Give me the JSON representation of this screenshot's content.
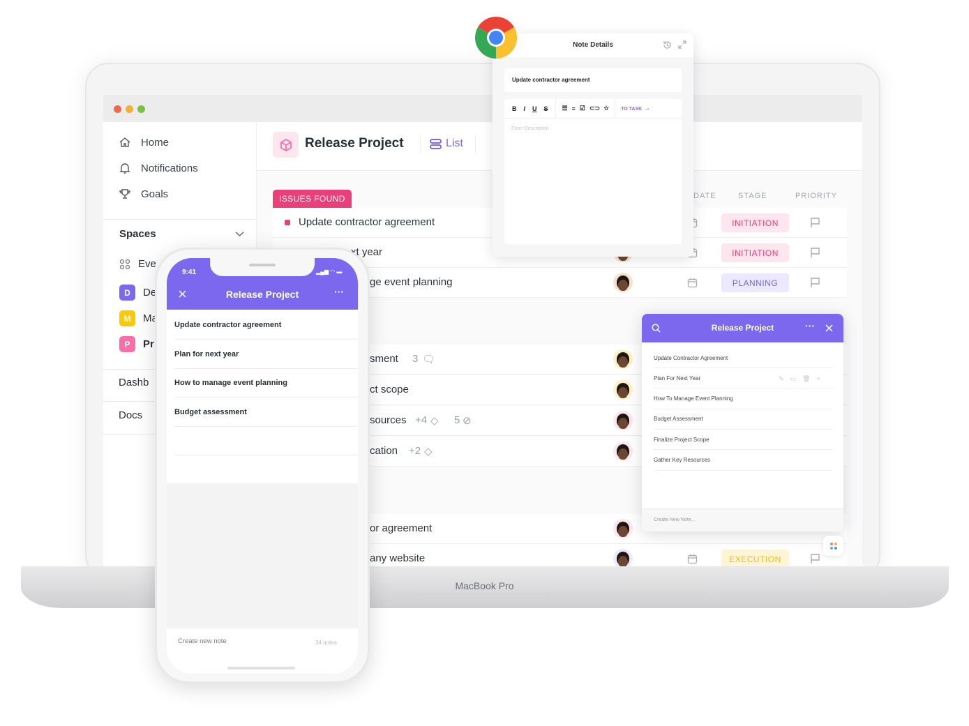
{
  "window": {
    "traffic_light_colors": [
      "#ee6a4a",
      "#f1b132",
      "#7ac142"
    ]
  },
  "sidebar": {
    "nav": [
      {
        "label": "Home",
        "icon": "home-icon"
      },
      {
        "label": "Notifications",
        "icon": "bell-icon"
      },
      {
        "label": "Goals",
        "icon": "trophy-icon"
      }
    ],
    "spaces_label": "Spaces",
    "spaces": [
      {
        "label": "Eve",
        "icon": "grid-icon"
      },
      {
        "badge": "D",
        "label": "De",
        "color": "#7b68ee"
      },
      {
        "badge": "M",
        "label": "Ma",
        "color": "#ffc800"
      },
      {
        "badge": "P",
        "label": "Pr",
        "color": "#f76fa8"
      }
    ],
    "dashboards": "Dashb",
    "docs": "Docs"
  },
  "header": {
    "title": "Release Project",
    "view": "List"
  },
  "columns": {
    "date": "DATE",
    "stage": "STAGE",
    "priority": "PRIORITY"
  },
  "group1": {
    "label": "ISSUES FOUND",
    "color": "#e9407a",
    "rows": [
      {
        "name": "Update contractor agreement",
        "stage": "INITIATION"
      },
      {
        "name": "xt year",
        "stage": "INITIATION"
      },
      {
        "name": "ge event planning",
        "stage": "PLANNING"
      }
    ]
  },
  "group2": {
    "rows": [
      {
        "name": "sment",
        "meta": "3"
      },
      {
        "name": "ct scope",
        "meta": ""
      },
      {
        "name": "sources",
        "meta": "+4",
        "meta2": "5"
      },
      {
        "name": "cation",
        "meta": "+2"
      }
    ]
  },
  "group3": {
    "rows": [
      {
        "name": "or agreement",
        "stage": ""
      },
      {
        "name": "any website",
        "stage": "EXECUTION"
      }
    ]
  },
  "stage_colors": {
    "INITIATION": [
      "#fde6ee",
      "#e9407a"
    ],
    "PLANNING": [
      "#ece8fd",
      "#7b68ee"
    ],
    "EXECUTION": [
      "#fff4d6",
      "#f2bd1d"
    ]
  },
  "note_details": {
    "title": "Note Details",
    "note_title": "Update contractor agreement",
    "toolbar": [
      "B",
      "I",
      "U",
      "S"
    ],
    "to_task": "TO TASK",
    "placeholder": "Enter Description"
  },
  "popup": {
    "title": "Release Project",
    "items": [
      "Update Contractor Agreement",
      "Plan For Next Year",
      "How To Manage Event Planning",
      "Budget Assessment",
      "Finalize Project Scope",
      "Gather Key Resources"
    ],
    "create": "Create New Note..."
  },
  "phone": {
    "time": "9:41",
    "title": "Release Project",
    "items": [
      "Update contractor agreement",
      "Plan for next year",
      "How to manage event planning",
      "Budget assessment"
    ],
    "create": "Create new note",
    "count": "34 notes"
  },
  "laptop_label": "MacBook Pro",
  "accent": "#7b68ee"
}
